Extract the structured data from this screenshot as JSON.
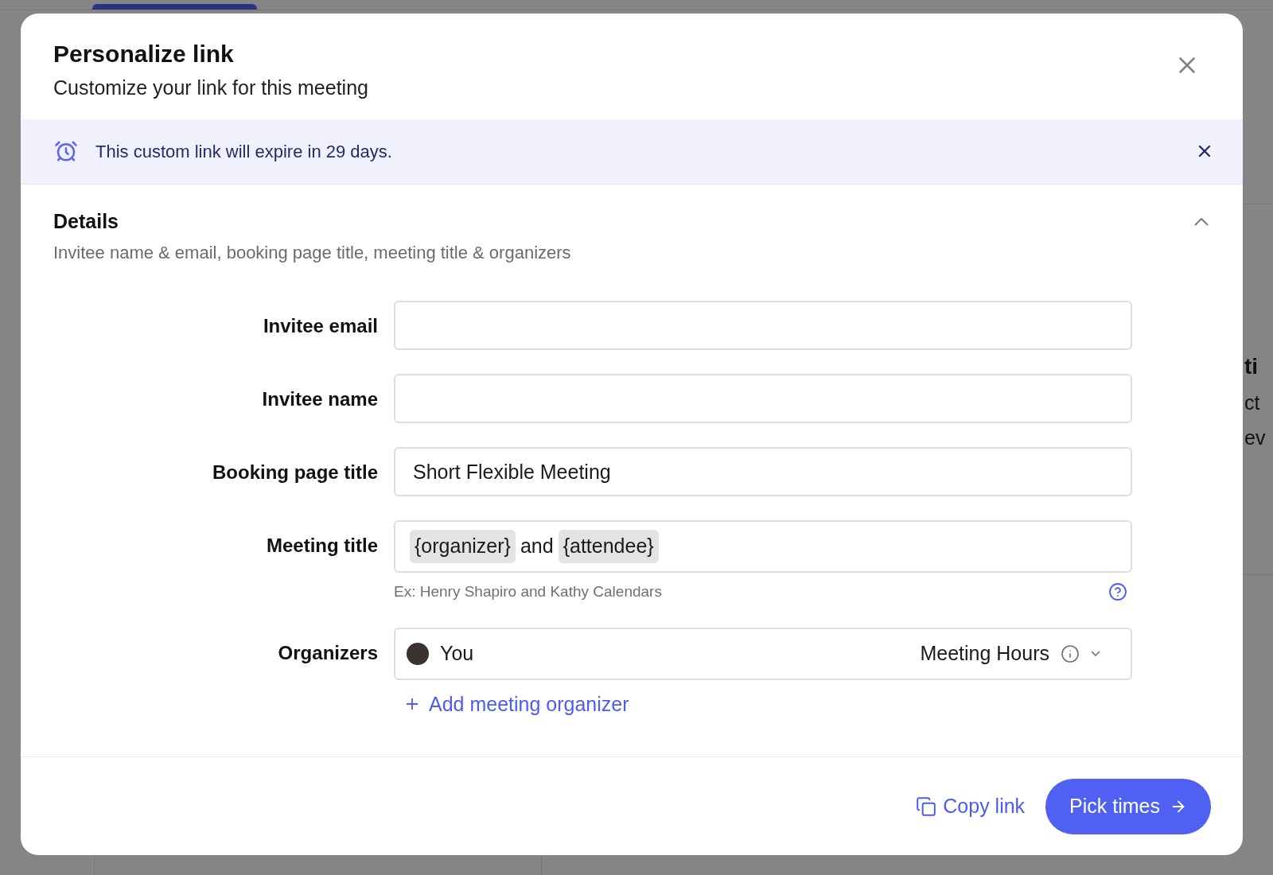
{
  "background": {
    "fragments": [
      {
        "text": "ti",
        "kind": "heading"
      },
      {
        "text": "ct",
        "kind": "body"
      },
      {
        "text": "ev",
        "kind": "body"
      }
    ]
  },
  "dialog": {
    "title": "Personalize link",
    "subtitle": "Customize your link for this meeting"
  },
  "notice": {
    "text": "This custom link will expire in 29 days."
  },
  "details": {
    "title": "Details",
    "subtitle": "Invitee name & email, booking page title, meeting title & organizers",
    "expanded": true,
    "fields": [
      {
        "label": "Invitee email",
        "kind": "input"
      },
      {
        "label": "Invitee name",
        "kind": "input"
      },
      {
        "label": "Booking page title",
        "kind": "input",
        "value": "Short Flexible Meeting"
      },
      {
        "label": "Meeting title",
        "kind": "tokens",
        "segments": [
          {
            "kind": "token",
            "text": "{organizer}"
          },
          {
            "kind": "text",
            "text": "and"
          },
          {
            "kind": "token",
            "text": "{attendee}"
          }
        ],
        "hint": "Ex: Henry Shapiro and Kathy Calendars"
      },
      {
        "label": "Organizers",
        "kind": "organizer",
        "name": "You",
        "hours": "Meeting Hours"
      }
    ],
    "add_label": "Add meeting organizer"
  },
  "footer": {
    "copy": "Copy link",
    "primary": "Pick times"
  }
}
